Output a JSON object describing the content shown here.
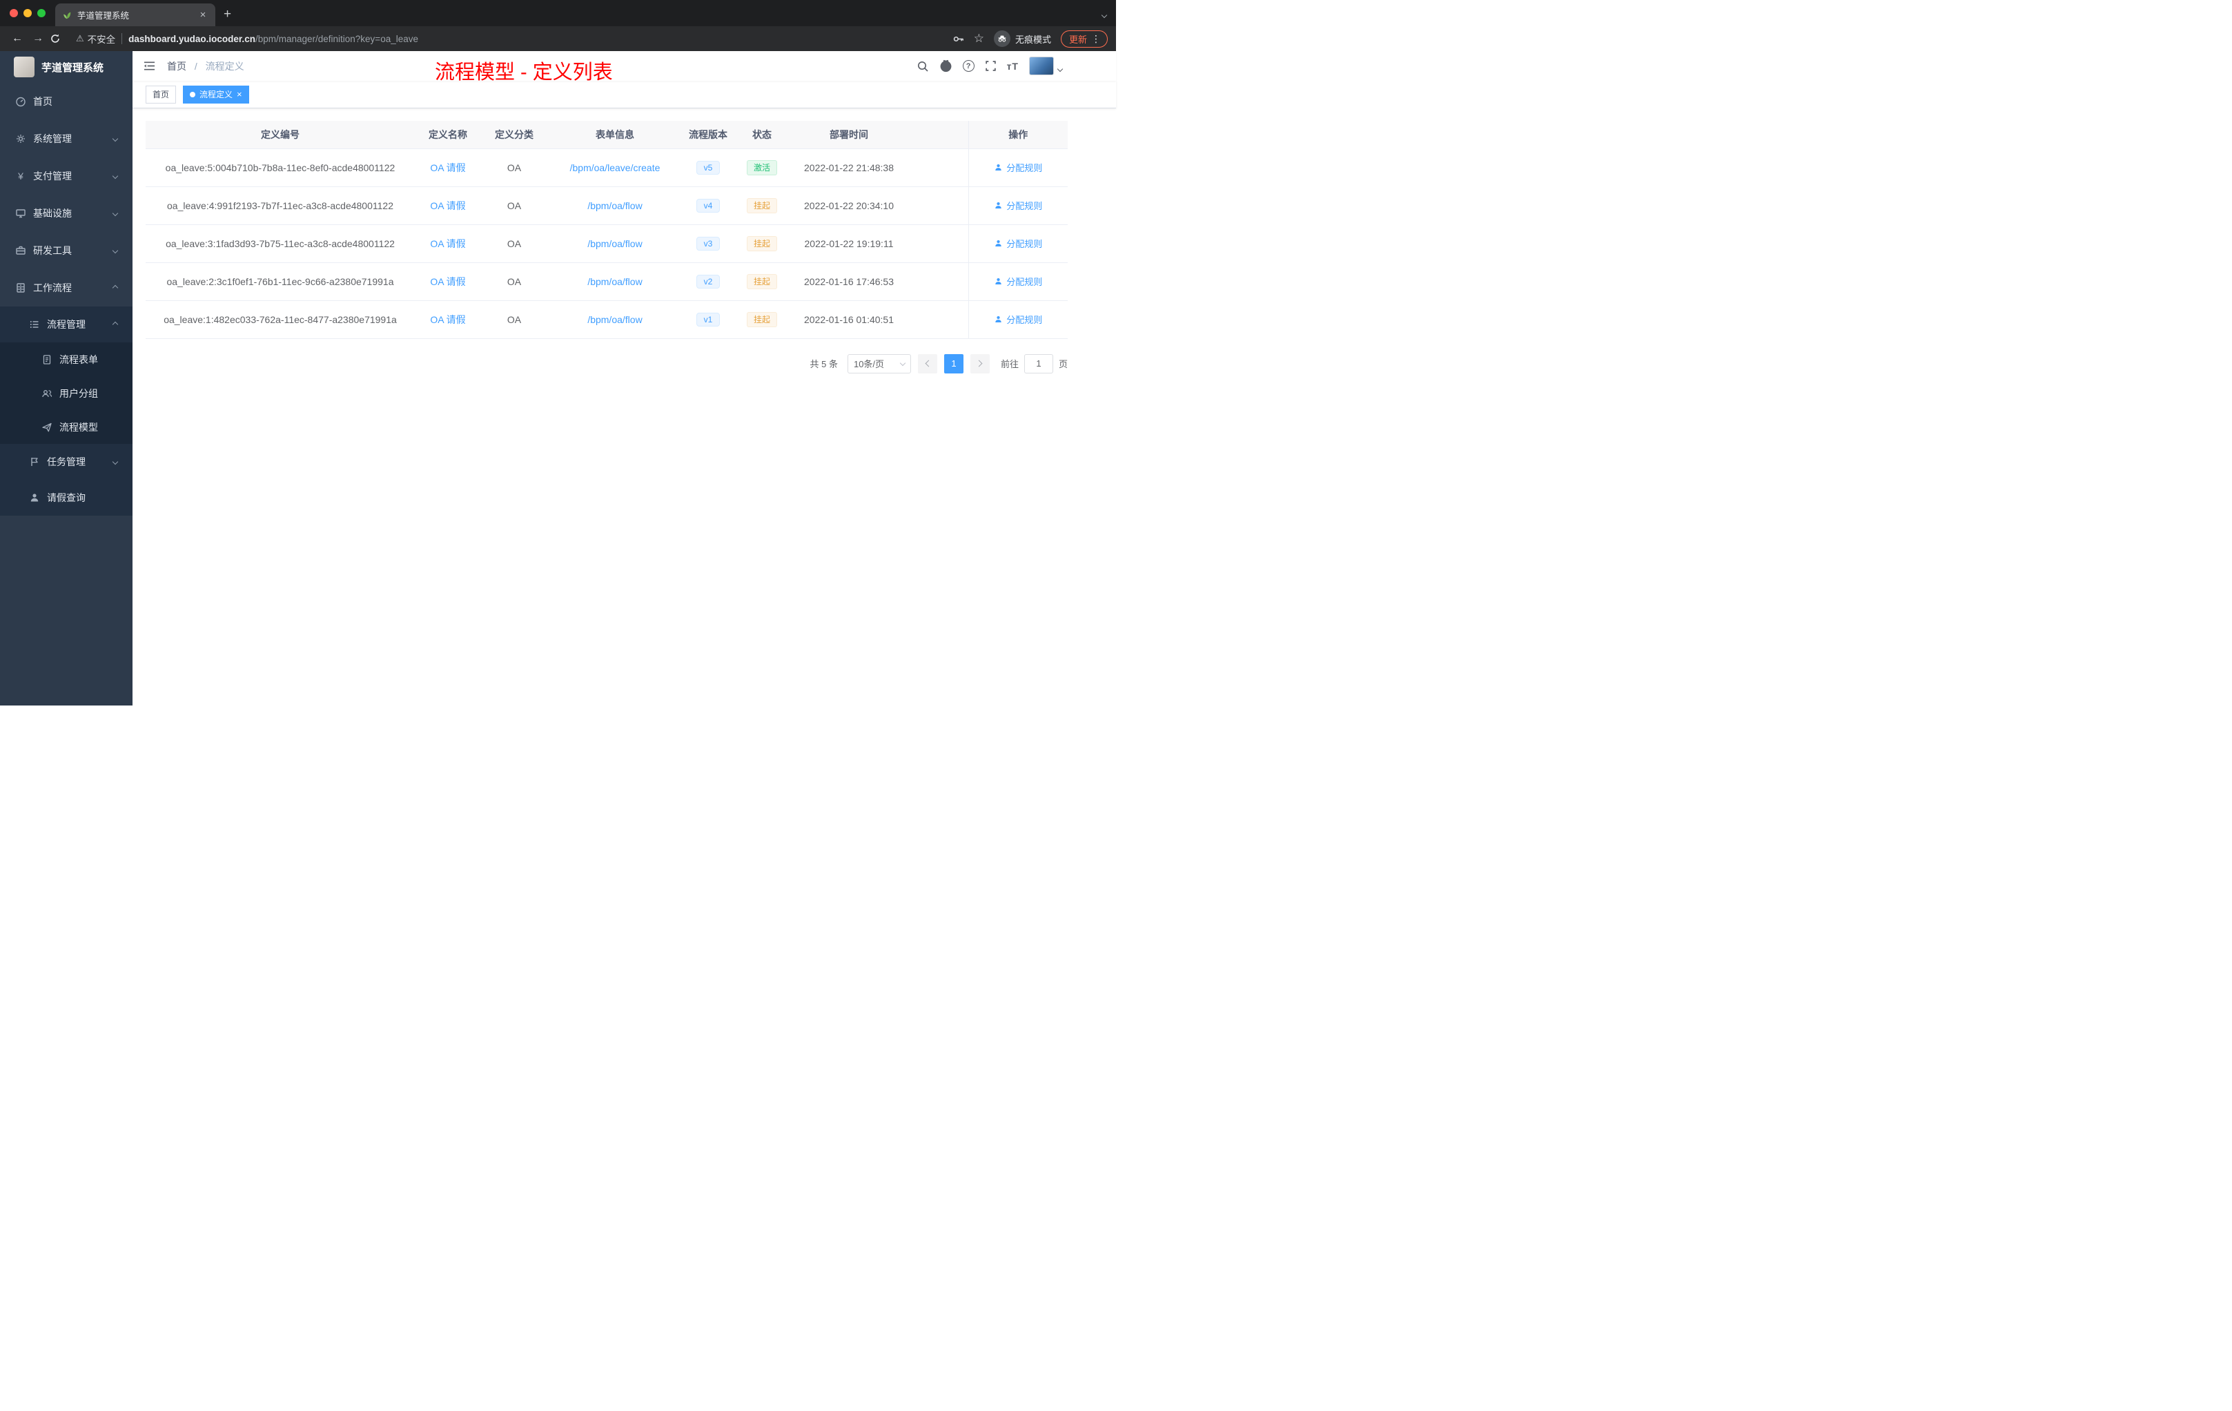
{
  "browser": {
    "tab_title": "芋道管理系统",
    "security_label": "不安全",
    "url_domain": "dashboard.yudao.iocoder.cn",
    "url_path": "/bpm/manager/definition?key=oa_leave",
    "incognito_label": "无痕模式",
    "update_label": "更新"
  },
  "icons": {
    "back": "←",
    "forward": "→",
    "warning": "⚠",
    "star": "☆",
    "more": "⋮",
    "close": "×",
    "plus": "+",
    "question": "?",
    "font_size": "тT"
  },
  "sidebar": {
    "logo_title": "芋道管理系统",
    "items": [
      {
        "label": "首页"
      },
      {
        "label": "系统管理"
      },
      {
        "label": "支付管理"
      },
      {
        "label": "基础设施"
      },
      {
        "label": "研发工具"
      },
      {
        "label": "工作流程"
      },
      {
        "label": "流程管理"
      },
      {
        "label": "流程表单"
      },
      {
        "label": "用户分组"
      },
      {
        "label": "流程模型"
      },
      {
        "label": "任务管理"
      },
      {
        "label": "请假查询"
      }
    ]
  },
  "header": {
    "breadcrumb_home": "首页",
    "breadcrumb_sep": "/",
    "breadcrumb_current": "流程定义",
    "annotation": "流程模型 - 定义列表"
  },
  "tags": {
    "home": "首页",
    "current": "流程定义"
  },
  "table": {
    "columns": [
      "定义编号",
      "定义名称",
      "定义分类",
      "表单信息",
      "流程版本",
      "状态",
      "部署时间",
      "操作"
    ],
    "action_label": "分配规则",
    "rows": [
      {
        "id": "oa_leave:5:004b710b-7b8a-11ec-8ef0-acde48001122",
        "name": "OA 请假",
        "category": "OA",
        "form": "/bpm/oa/leave/create",
        "version": "v5",
        "status": "激活",
        "time": "2022-01-22 21:48:38"
      },
      {
        "id": "oa_leave:4:991f2193-7b7f-11ec-a3c8-acde48001122",
        "name": "OA 请假",
        "category": "OA",
        "form": "/bpm/oa/flow",
        "version": "v4",
        "status": "挂起",
        "time": "2022-01-22 20:34:10"
      },
      {
        "id": "oa_leave:3:1fad3d93-7b75-11ec-a3c8-acde48001122",
        "name": "OA 请假",
        "category": "OA",
        "form": "/bpm/oa/flow",
        "version": "v3",
        "status": "挂起",
        "time": "2022-01-22 19:19:11"
      },
      {
        "id": "oa_leave:2:3c1f0ef1-76b1-11ec-9c66-a2380e71991a",
        "name": "OA 请假",
        "category": "OA",
        "form": "/bpm/oa/flow",
        "version": "v2",
        "status": "挂起",
        "time": "2022-01-16 17:46:53"
      },
      {
        "id": "oa_leave:1:482ec033-762a-11ec-8477-a2380e71991a",
        "name": "OA 请假",
        "category": "OA",
        "form": "/bpm/oa/flow",
        "version": "v1",
        "status": "挂起",
        "time": "2022-01-16 01:40:51"
      }
    ]
  },
  "pagination": {
    "total": "共 5 条",
    "page_size": "10条/页",
    "current_page": "1",
    "goto_label": "前往",
    "goto_value": "1",
    "page_unit": "页"
  },
  "colors": {
    "accent": "#409eff",
    "success": "#1dbf73",
    "warning": "#e6a23c",
    "annotation": "#ff0000"
  }
}
